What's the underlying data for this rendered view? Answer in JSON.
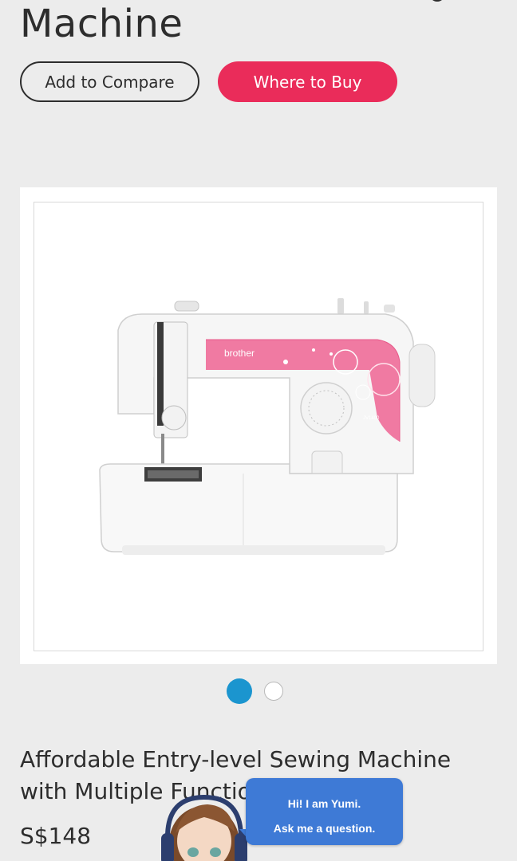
{
  "header": {
    "title": "Machine"
  },
  "actions": {
    "compare_label": "Add to Compare",
    "buy_label": "Where to Buy"
  },
  "product": {
    "brand": "brother",
    "model": "JV1400",
    "description": "Affordable Entry-level Sewing Machine with Multiple Functions",
    "price": "S$148"
  },
  "gallery": {
    "slide_count": 2,
    "active_slide": 1
  },
  "chat": {
    "greeting": "Hi! I am Yumi.",
    "prompt": "Ask me a question."
  },
  "colors": {
    "accent": "#ea2c5a",
    "active_dot": "#1b95cf",
    "chat_bubble": "#3e7ad6"
  }
}
